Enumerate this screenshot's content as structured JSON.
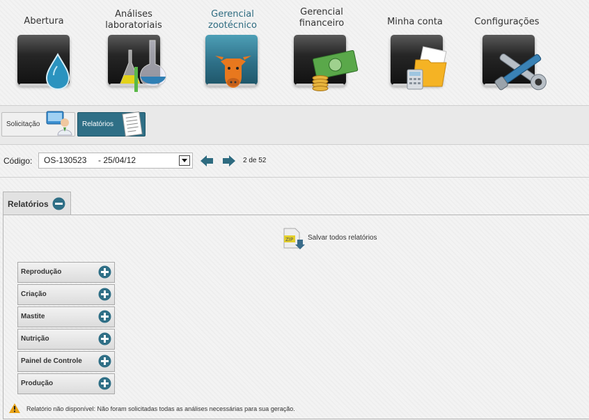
{
  "nav": {
    "items": [
      {
        "label_line1": "Abertura",
        "label_line2": "",
        "icon": "drop-icon"
      },
      {
        "label_line1": "Análises",
        "label_line2": "laboratoriais",
        "icon": "lab-flasks-icon"
      },
      {
        "label_line1": "Gerencial",
        "label_line2": "zootécnico",
        "icon": "cow-icon",
        "active": true
      },
      {
        "label_line1": "Gerencial",
        "label_line2": "financeiro",
        "icon": "money-icon"
      },
      {
        "label_line1": "Minha conta",
        "label_line2": "",
        "icon": "account-folder-icon"
      },
      {
        "label_line1": "Configurações",
        "label_line2": "",
        "icon": "tools-icon"
      }
    ],
    "active_color": "#2e6b80"
  },
  "subtabs": {
    "solicitacao": "Solicitação",
    "relatorios": "Relatórios"
  },
  "code": {
    "label": "Código:",
    "value": "OS-130523     - 25/04/12",
    "counter": "2 de 52"
  },
  "panel": {
    "title": "Relatórios",
    "save_all": "Salvar todos relatórios",
    "categories": [
      "Reprodução",
      "Criação",
      "Mastite",
      "Nutrição",
      "Painel de Controle",
      "Produção"
    ],
    "warning": "Relatório não disponível: Não foram solicitadas todas as análises necessárias para sua geração."
  },
  "colors": {
    "accent": "#2f6f86",
    "warning": "#e8a317"
  }
}
